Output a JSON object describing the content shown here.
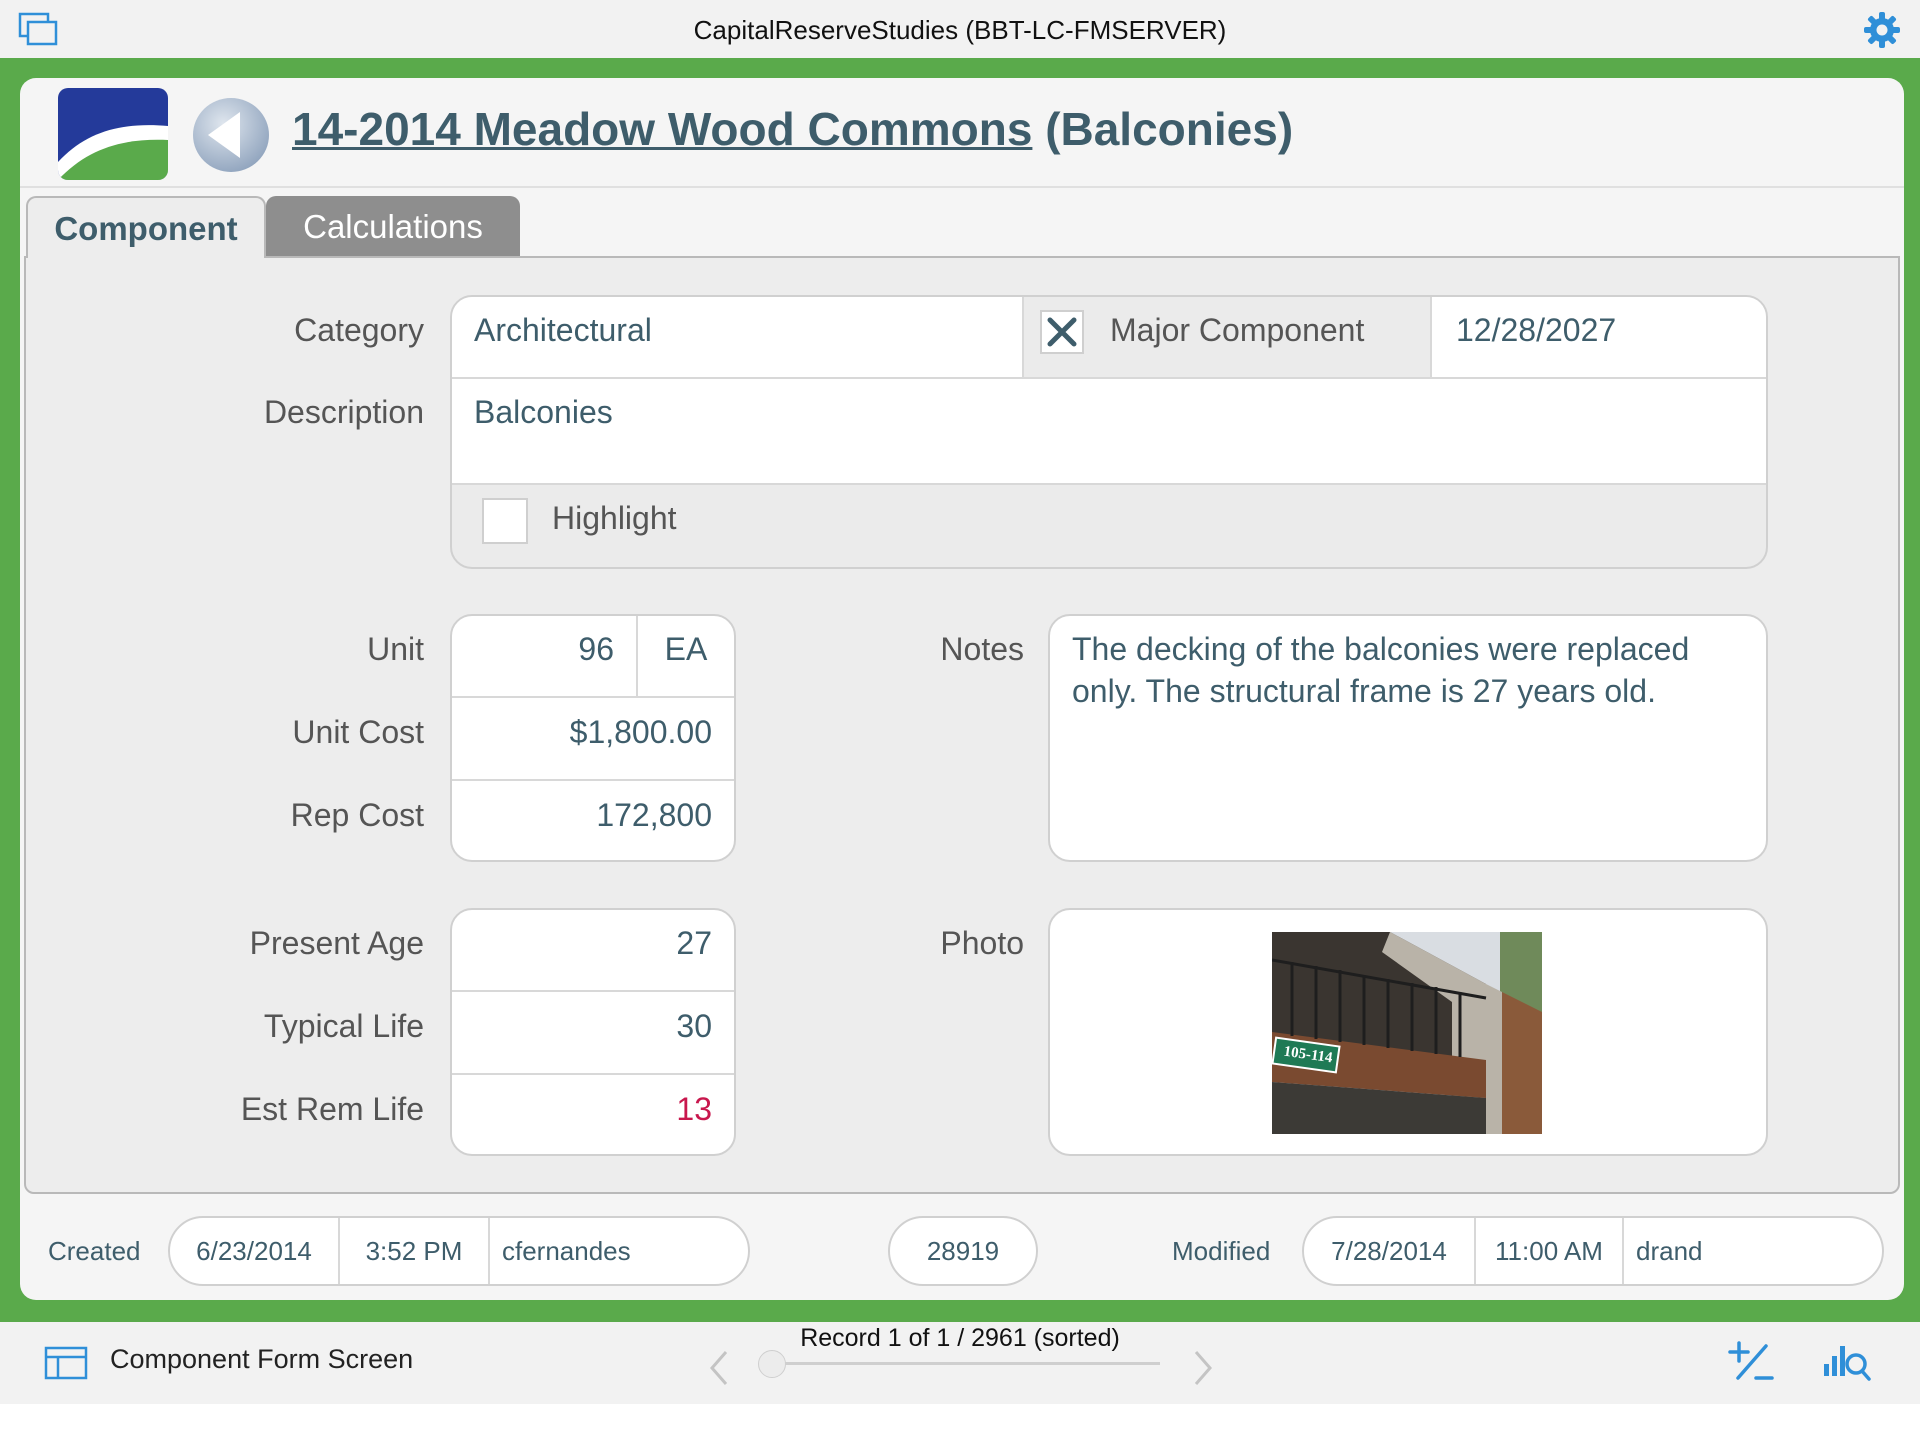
{
  "app": {
    "title": "CapitalReserveStudies (BBT-LC-FMSERVER)"
  },
  "header": {
    "title_link": "14-2014 Meadow Wood Commons",
    "title_suffix": "(Balconies)"
  },
  "tabs": [
    {
      "label": "Component",
      "active": true
    },
    {
      "label": "Calculations",
      "active": false
    }
  ],
  "form": {
    "category": {
      "label": "Category",
      "value": "Architectural"
    },
    "major_component": {
      "label": "Major Component",
      "checked": true,
      "date": "12/28/2027"
    },
    "description": {
      "label": "Description",
      "value": "Balconies"
    },
    "highlight": {
      "label": "Highlight",
      "checked": false
    },
    "unit": {
      "label": "Unit",
      "quantity": "96",
      "measure": "EA"
    },
    "unit_cost": {
      "label": "Unit Cost",
      "value": "$1,800.00"
    },
    "rep_cost": {
      "label": "Rep Cost",
      "value": "172,800"
    },
    "notes": {
      "label": "Notes",
      "value": "The decking of the balconies were replaced only. The structural frame is 27 years old."
    },
    "present_age": {
      "label": "Present Age",
      "value": "27"
    },
    "typical_life": {
      "label": "Typical Life",
      "value": "30"
    },
    "est_rem_life": {
      "label": "Est Rem Life",
      "value": "13"
    },
    "photo": {
      "label": "Photo",
      "sign_text": "105-114"
    }
  },
  "footer": {
    "created_label": "Created",
    "created_date": "6/23/2014",
    "created_time": "3:52 PM",
    "created_by": "cfernandes",
    "record_id": "28919",
    "modified_label": "Modified",
    "modified_date": "7/28/2014",
    "modified_time": "11:00 AM",
    "modified_by": "drand"
  },
  "toolbar": {
    "layout_name": "Component Form Screen",
    "record_info": "Record 1 of 1 / 2961 (sorted)"
  },
  "colors": {
    "frame_green": "#5aaa4b",
    "text_teal": "#3e5d6b",
    "accent_blue": "#2f8fd8",
    "alert_red": "#c8174d"
  },
  "icons": [
    "windows-icon",
    "settings-icon",
    "back-arrow-icon",
    "layout-icon",
    "new-record-icon",
    "find-icon",
    "chevron-left-icon",
    "chevron-right-icon",
    "checkmark-x-icon"
  ]
}
